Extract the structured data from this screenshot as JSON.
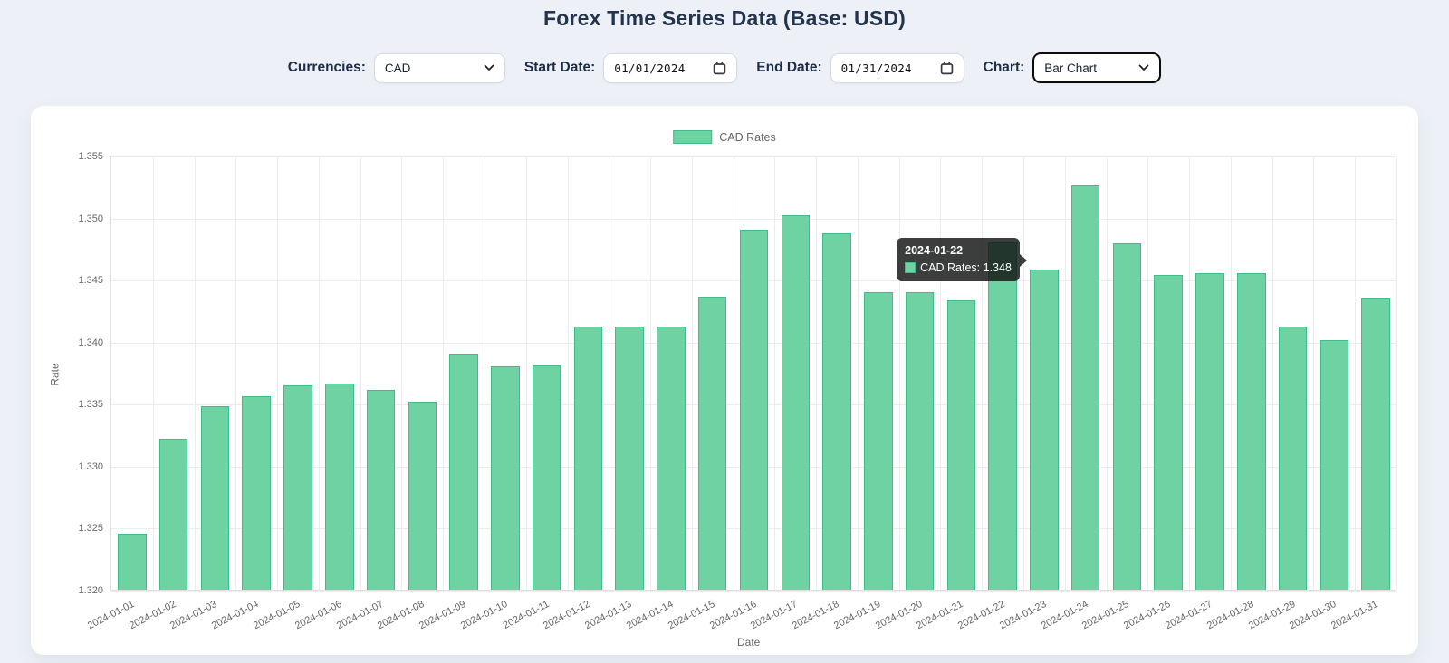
{
  "header": {
    "title": "Forex Time Series Data (Base: USD)"
  },
  "controls": {
    "currencies_label": "Currencies:",
    "currency_value": "CAD",
    "start_date_label": "Start Date:",
    "start_date_value": "01/01/2024",
    "end_date_label": "End Date:",
    "end_date_value": "01/31/2024",
    "chart_label": "Chart:",
    "chart_value": "Bar Chart"
  },
  "icons": {
    "currency_select": "chevron-down-icon",
    "chart_select": "chevron-down-icon",
    "start_date": "calendar-icon",
    "end_date": "calendar-icon"
  },
  "tooltip": {
    "title": "2024-01-22",
    "label": "CAD Rates: 1.348"
  },
  "colors": {
    "page_bg": "#edf1f7",
    "card_bg": "#ffffff",
    "title_text": "#24344e",
    "label_text": "#666666",
    "grid_line": "#ececec",
    "bar_fill": "#6fd2a2",
    "bar_border": "#3cbf8b",
    "tooltip_bg": "rgba(17,20,19,0.82)"
  },
  "chart_data": {
    "type": "bar",
    "title": "",
    "xlabel": "Date",
    "ylabel": "Rate",
    "ylim": [
      1.32,
      1.355
    ],
    "ytick_step": 0.005,
    "grid": true,
    "legend_position": "top",
    "categories": [
      "2024-01-01",
      "2024-01-02",
      "2024-01-03",
      "2024-01-04",
      "2024-01-05",
      "2024-01-06",
      "2024-01-07",
      "2024-01-08",
      "2024-01-09",
      "2024-01-10",
      "2024-01-11",
      "2024-01-12",
      "2024-01-13",
      "2024-01-14",
      "2024-01-15",
      "2024-01-16",
      "2024-01-17",
      "2024-01-18",
      "2024-01-19",
      "2024-01-20",
      "2024-01-21",
      "2024-01-22",
      "2024-01-23",
      "2024-01-24",
      "2024-01-25",
      "2024-01-26",
      "2024-01-27",
      "2024-01-28",
      "2024-01-29",
      "2024-01-30",
      "2024-01-31"
    ],
    "series": [
      {
        "name": "CAD Rates",
        "values": [
          1.3245,
          1.3322,
          1.3348,
          1.3356,
          1.3365,
          1.3366,
          1.3361,
          1.3352,
          1.339,
          1.338,
          1.3381,
          1.3412,
          1.3412,
          1.3412,
          1.3436,
          1.349,
          1.3502,
          1.3487,
          1.344,
          1.344,
          1.3433,
          1.348,
          1.3458,
          1.3526,
          1.3479,
          1.3454,
          1.3455,
          1.3455,
          1.3412,
          1.3401,
          1.3435
        ]
      }
    ],
    "highlight_index": 21,
    "highlight_value": 1.348
  }
}
